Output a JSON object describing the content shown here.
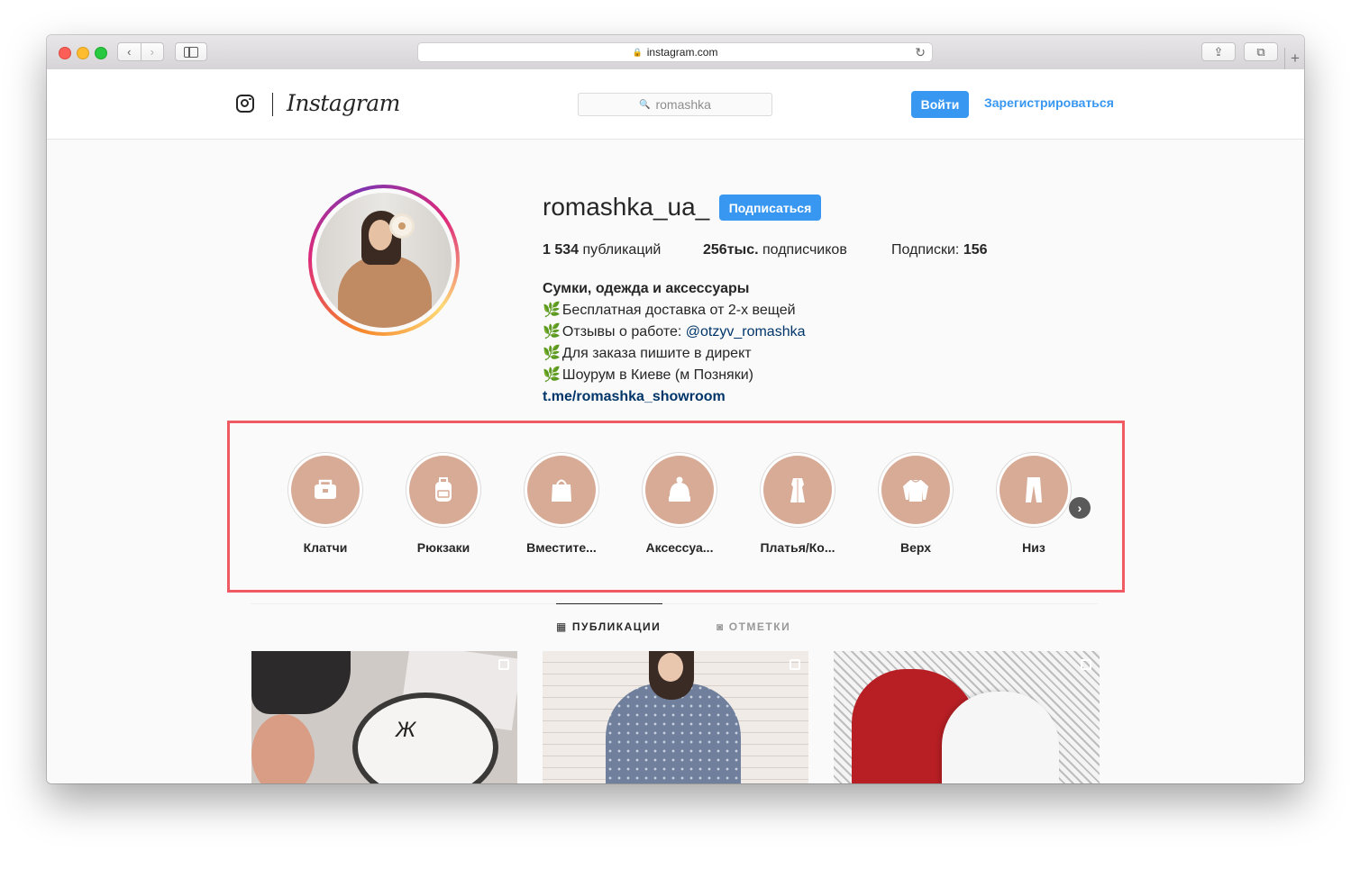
{
  "browser": {
    "url": "instagram.com"
  },
  "header": {
    "logo_text": "Instagram",
    "search_value": "romashka",
    "login_label": "Войти",
    "signup_label": "Зарегистрироваться"
  },
  "profile": {
    "username": "romashka_ua_",
    "follow_label": "Подписаться",
    "stats": {
      "posts_count": "1 534",
      "posts_label": "публикаций",
      "followers_count": "256тыс.",
      "followers_label": "подписчиков",
      "following_label": "Подписки:",
      "following_count": "156"
    },
    "bio": {
      "name": "Сумки, одежда и аксессуары",
      "leaf": "🌿",
      "line1": "Бесплатная доставка от 2-х вещей",
      "line2_prefix": "Отзывы о работе: ",
      "line2_mention": "@otzyv_romashka",
      "line3": "Для заказа пишите в директ",
      "line4": "Шоурум в Киеве (м Позняки)",
      "link": "t.me/romashka_showroom"
    }
  },
  "highlights": [
    {
      "label": "Клатчи",
      "icon": "clutch-icon"
    },
    {
      "label": "Рюкзаки",
      "icon": "backpack-icon"
    },
    {
      "label": "Вместите...",
      "icon": "tote-bag-icon"
    },
    {
      "label": "Аксессуа...",
      "icon": "beanie-hat-icon"
    },
    {
      "label": "Платья/Ко...",
      "icon": "dress-icon"
    },
    {
      "label": "Верх",
      "icon": "sweater-icon"
    },
    {
      "label": "Низ",
      "icon": "trousers-icon"
    }
  ],
  "tabs": {
    "posts_label": "ПУБЛИКАЦИИ",
    "tagged_label": "ОТМЕТКИ"
  },
  "colors": {
    "accent": "#3897f0",
    "highlight_fill": "#d8ab96",
    "annotation_frame": "#ef5a63"
  }
}
